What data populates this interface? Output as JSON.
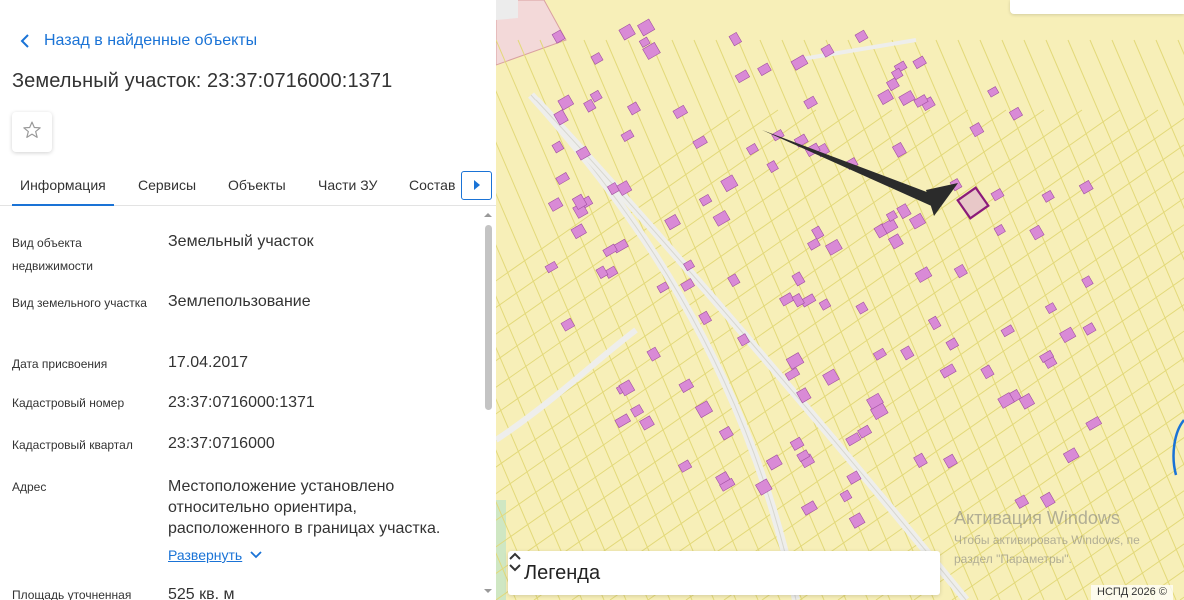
{
  "panel": {
    "back_label": "Назад в найденные объекты",
    "title": "Земельный участок: 23:37:0716000:1371",
    "tabs": [
      {
        "label": "Информация",
        "active": true
      },
      {
        "label": "Сервисы"
      },
      {
        "label": "Объекты"
      },
      {
        "label": "Части ЗУ"
      },
      {
        "label": "Состав"
      }
    ],
    "rows": [
      {
        "label": "Вид объекта недвижимости",
        "value": "Земельный участок"
      },
      {
        "label": "Вид земельного участка",
        "value": "Землепользование"
      },
      {
        "label": "Дата присвоения",
        "value": "17.04.2017"
      },
      {
        "label": "Кадастровый номер",
        "value": "23:37:0716000:1371"
      },
      {
        "label": "Кадастровый квартал",
        "value": "23:37:0716000"
      },
      {
        "label": "Адрес",
        "value": "Местоположение установлено относительно ориентира, расположенного в границах участка."
      },
      {
        "label": "Площадь уточненная",
        "value": "525 кв. м"
      }
    ],
    "expand_label": "Развернуть"
  },
  "map": {
    "legend_label": "Легенда",
    "watermark_title": "Активация Windows",
    "watermark_line1": "Чтобы активировать Windows, пе",
    "watermark_line2": "раздел \"Параметры\".",
    "copyright": "НСПД 2026 ©",
    "colors": {
      "land": "#f7efb8",
      "parcel_line": "#e3d97a",
      "road": "#f2f2ef",
      "building": "#d98ad6",
      "building_stroke": "#a04fa0",
      "selected": "#8b1a7a",
      "arrow": "#2b2b2b",
      "accent": "#1a73d6"
    }
  }
}
